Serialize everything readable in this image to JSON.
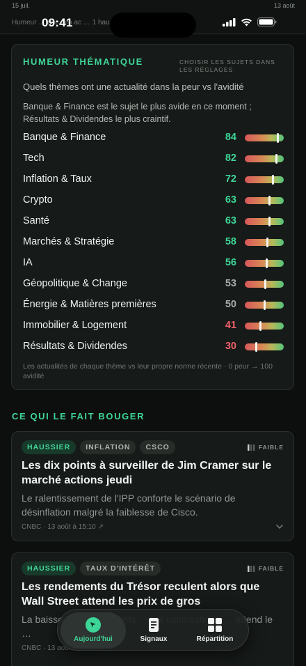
{
  "top_chart": {
    "date_start": "15 juil.",
    "date_end": "13 août",
    "caption": "Humeur … une des ac … 1 hau …"
  },
  "status_bar": {
    "time": "09:41"
  },
  "humeur": {
    "title": "HUMEUR THÉMATIQUE",
    "settings_hint": "CHOISIR LES SUJETS DANS LES RÉGLAGES",
    "question": "Quels thèmes ont une actualité dans la peur vs l'avidité",
    "summary": "Banque & Finance est le sujet le plus avide en ce moment ; Résultats & Dividendes le plus craintif.",
    "themes": [
      {
        "name": "Banque & Finance",
        "score": 84,
        "color": "#3ed598"
      },
      {
        "name": "Tech",
        "score": 82,
        "color": "#3ed598"
      },
      {
        "name": "Inflation & Taux",
        "score": 72,
        "color": "#3ed598"
      },
      {
        "name": "Crypto",
        "score": 63,
        "color": "#3ed598"
      },
      {
        "name": "Santé",
        "score": 63,
        "color": "#3ed598"
      },
      {
        "name": "Marchés & Stratégie",
        "score": 58,
        "color": "#3ed598"
      },
      {
        "name": "IA",
        "score": 56,
        "color": "#3ed598"
      },
      {
        "name": "Géopolitique & Change",
        "score": 53,
        "color": "#a6aca8"
      },
      {
        "name": "Énergie & Matières premières",
        "score": 50,
        "color": "#a6aca8"
      },
      {
        "name": "Immobilier & Logement",
        "score": 41,
        "color": "#f0606a"
      },
      {
        "name": "Résultats & Dividendes",
        "score": 30,
        "color": "#f0606a"
      }
    ],
    "footnote": "Les actualités de chaque thème vs leur propre norme récente · 0 peur → 100 avidité"
  },
  "drivers": {
    "title": "CE QUI LE FAIT BOUGER",
    "items": [
      {
        "tags": [
          "HAUSSIER",
          "INFLATION",
          "CSCO"
        ],
        "strength": "FAIBLE",
        "headline": "Les dix points à surveiller de Jim Cramer sur le marché actions jeudi",
        "summary": "Le ralentissement de l'IPP conforte le scénario de désinflation malgré la faiblesse de Cisco.",
        "meta": "CNBC · 13 août à 15:10 ↗"
      },
      {
        "tags": [
          "HAUSSIER",
          "TAUX D'INTÉRÊT"
        ],
        "strength": "FAIBLE",
        "headline": "Les rendements du Trésor reculent alors que Wall Street attend les prix de gros",
        "summary": "La baisse des rendements … les valorisations … attend le …",
        "meta": "CNBC · 13 août à 15:00 ↗"
      }
    ]
  },
  "tabbar": {
    "tabs": [
      {
        "label": "Aujourd'hui",
        "icon": "compass-icon",
        "active": true
      },
      {
        "label": "Signaux",
        "icon": "document-icon",
        "active": false
      },
      {
        "label": "Répartition",
        "icon": "grid-icon",
        "active": false
      }
    ]
  }
}
